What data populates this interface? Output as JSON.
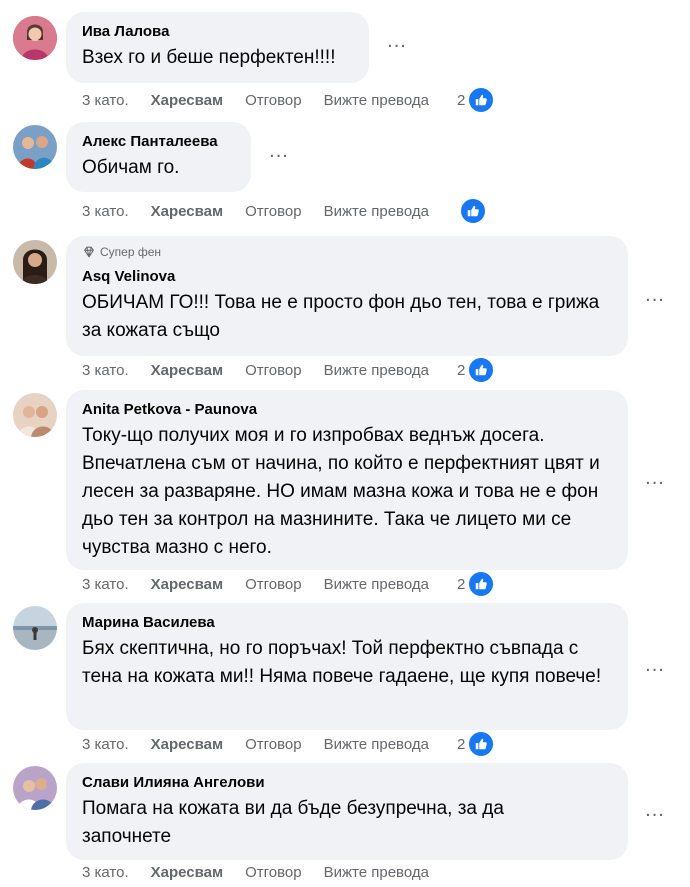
{
  "comments": [
    {
      "author": "Ива Лалова",
      "badge": "",
      "text": "Взех го и беше перфектен!!!!",
      "time": "3 като.",
      "like_label": "Харесвам",
      "reply_label": "Отговор",
      "translate_label": "Вижте превода",
      "reaction_count": "2",
      "avatar_color": "#b84d6a"
    },
    {
      "author": "Алекс Панталеева",
      "badge": "",
      "text": "Обичам го.",
      "time": "3 като.",
      "like_label": "Харесвам",
      "reply_label": "Отговор",
      "translate_label": "Вижте превода",
      "reaction_count": "",
      "avatar_color": "#6a8cb8"
    },
    {
      "author": "Asq Velinova",
      "badge": "Супер фен",
      "text": "ОБИЧАМ ГО!!! Това не е просто фон дьо тен, това е грижа за кожата също",
      "time": "3 като.",
      "like_label": "Харесвам",
      "reply_label": "Отговор",
      "translate_label": "Вижте превода",
      "reaction_count": "2",
      "avatar_color": "#5a4a3e"
    },
    {
      "author": "Anita Petkova - Paunova",
      "badge": "",
      "text": "Току-що получих моя и го изпробвах веднъж досега. Впечатлена съм от начина, по който е перфектният цвят и лесен за разваряне. НО имам мазна кожа и това не е фон дьо тен за контрол на мазнините. Така че лицето ми се чувства мазно с него.",
      "time": "3 като.",
      "like_label": "Харесвам",
      "reply_label": "Отговор",
      "translate_label": "Вижте превода",
      "reaction_count": "2",
      "avatar_color": "#c4a08a"
    },
    {
      "author": "Марина Василева",
      "badge": "",
      "text": "Бях скептична, но го поръчах! Той перфектно съвпада с тена на кожата ми!! Няма повече гадаене, ще купя повече!",
      "time": "3 като.",
      "like_label": "Харесвам",
      "reply_label": "Отговор",
      "translate_label": "Вижте превода",
      "reaction_count": "2",
      "avatar_color": "#8fa6b8"
    },
    {
      "author": "Слави Илияна Ангелови",
      "badge": "",
      "text": "Помага на кожата ви да бъде безупречна, за да започнете",
      "time": "3 като.",
      "like_label": "Харесвам",
      "reply_label": "Отговор",
      "translate_label": "Вижте превода",
      "reaction_count": "",
      "avatar_color": "#a98bb8"
    }
  ],
  "more_label": "..."
}
